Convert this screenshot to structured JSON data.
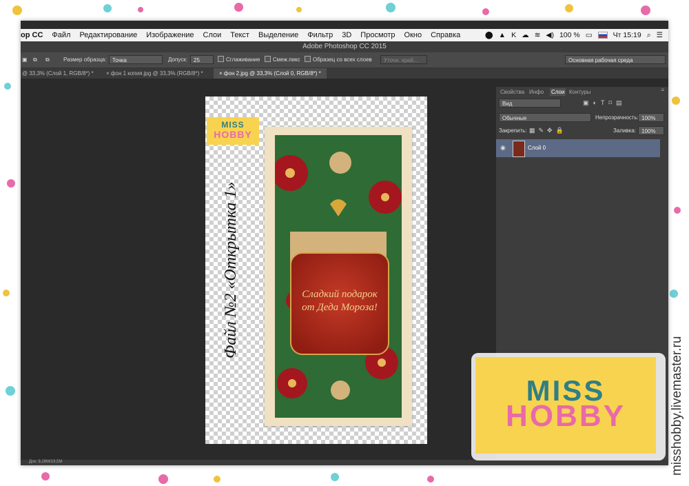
{
  "menubar": {
    "app": "ор CC",
    "items": [
      "Файл",
      "Редактирование",
      "Изображение",
      "Слои",
      "Текст",
      "Выделение",
      "Фильтр",
      "3D",
      "Просмотр",
      "Окно",
      "Справка"
    ],
    "battery": "100 %",
    "clock": "Чт 15:19"
  },
  "window": {
    "title": "Adobe Photoshop CC 2015"
  },
  "options": {
    "sample_size_label": "Размер образца:",
    "sample_size_value": "Точка",
    "tolerance_label": "Допуск:",
    "tolerance_value": "25",
    "antialias_label": "Сглаживание",
    "contiguous_label": "Смеж.пикс",
    "all_layers_label": "Образец со всех слоев",
    "refine_label": "Уточн. край...",
    "workspace_value": "Основная рабочая среда"
  },
  "tabs": [
    {
      "label": "@ 33,3% (Слой 1, RGB/8*) *"
    },
    {
      "label": "фон 1 копия.jpg @ 33,3% (RGB/8*) *"
    },
    {
      "label": "фон 2.jpg @ 33,3% (Слой 0, RGB/8*) *"
    }
  ],
  "canvas": {
    "rotated_caption": "Файл №2 «Открытка 1»",
    "card_text_line1": "Сладкий подарок",
    "card_text_line2": "от Деда Мороза!",
    "logo_word1": "MISS",
    "logo_word2": "HOBBY"
  },
  "panel": {
    "tabs": [
      "Свойства",
      "Инфо",
      "Слои",
      "Контуры"
    ],
    "filter_value": "Вид",
    "blend_value": "Обычные",
    "opacity_label": "Непрозрачность:",
    "opacity_value": "100%",
    "lock_label": "Закрепить:",
    "fill_label": "Заливка:",
    "fill_value": "100%",
    "layer_name": "Слой 0"
  },
  "status": {
    "doc": "Док: 9,28М/19,5М"
  },
  "logo": {
    "word1": "MISS",
    "word2": "HOBBY"
  },
  "watermark": "misshobby.livemaster.ru",
  "colors": {
    "accent_yellow": "#f8d350",
    "logo_teal": "#2e7f86",
    "logo_pink": "#e86aa8",
    "layer_highlight": "#5d6a86"
  }
}
